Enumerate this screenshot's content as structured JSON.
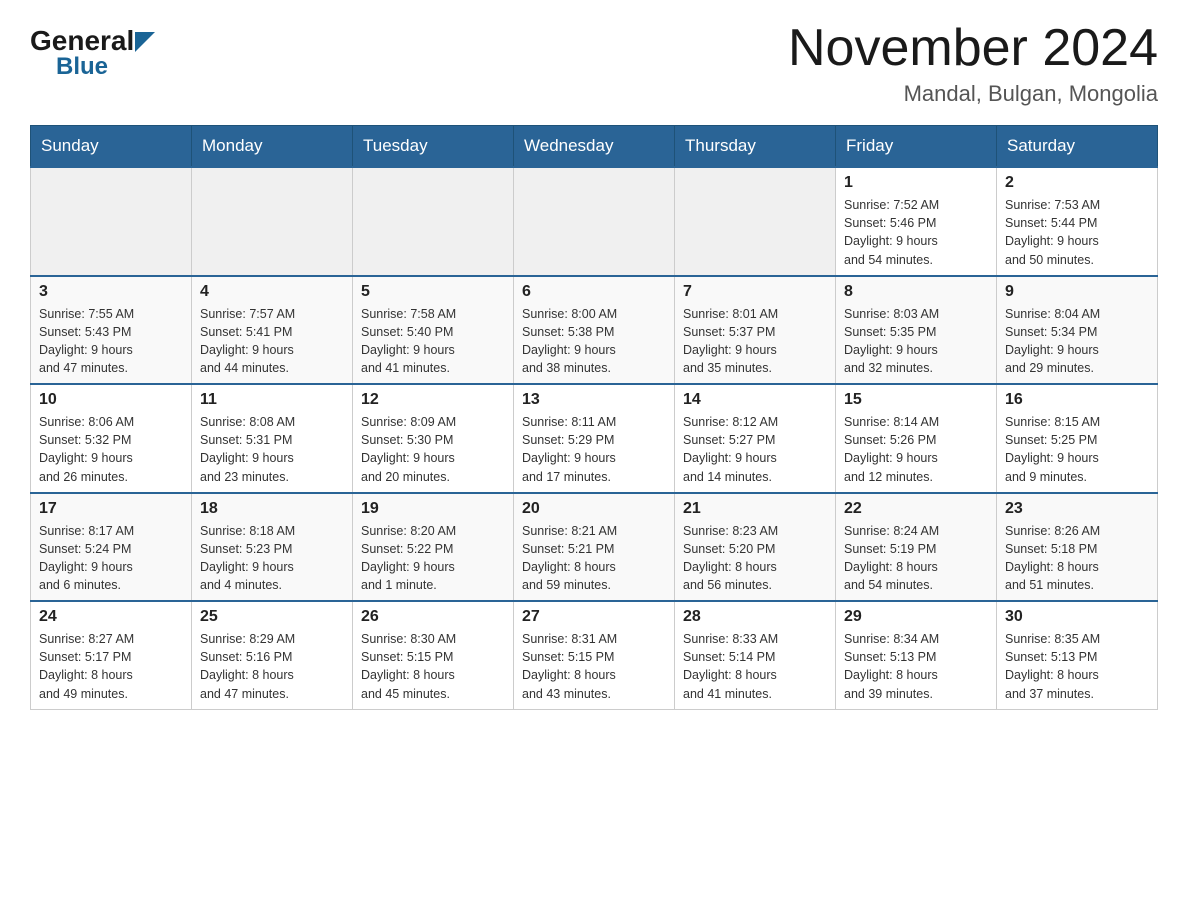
{
  "header": {
    "logo_general": "General",
    "logo_blue": "Blue",
    "title": "November 2024",
    "subtitle": "Mandal, Bulgan, Mongolia"
  },
  "weekdays": [
    "Sunday",
    "Monday",
    "Tuesday",
    "Wednesday",
    "Thursday",
    "Friday",
    "Saturday"
  ],
  "weeks": [
    [
      {
        "day": "",
        "info": ""
      },
      {
        "day": "",
        "info": ""
      },
      {
        "day": "",
        "info": ""
      },
      {
        "day": "",
        "info": ""
      },
      {
        "day": "",
        "info": ""
      },
      {
        "day": "1",
        "info": "Sunrise: 7:52 AM\nSunset: 5:46 PM\nDaylight: 9 hours\nand 54 minutes."
      },
      {
        "day": "2",
        "info": "Sunrise: 7:53 AM\nSunset: 5:44 PM\nDaylight: 9 hours\nand 50 minutes."
      }
    ],
    [
      {
        "day": "3",
        "info": "Sunrise: 7:55 AM\nSunset: 5:43 PM\nDaylight: 9 hours\nand 47 minutes."
      },
      {
        "day": "4",
        "info": "Sunrise: 7:57 AM\nSunset: 5:41 PM\nDaylight: 9 hours\nand 44 minutes."
      },
      {
        "day": "5",
        "info": "Sunrise: 7:58 AM\nSunset: 5:40 PM\nDaylight: 9 hours\nand 41 minutes."
      },
      {
        "day": "6",
        "info": "Sunrise: 8:00 AM\nSunset: 5:38 PM\nDaylight: 9 hours\nand 38 minutes."
      },
      {
        "day": "7",
        "info": "Sunrise: 8:01 AM\nSunset: 5:37 PM\nDaylight: 9 hours\nand 35 minutes."
      },
      {
        "day": "8",
        "info": "Sunrise: 8:03 AM\nSunset: 5:35 PM\nDaylight: 9 hours\nand 32 minutes."
      },
      {
        "day": "9",
        "info": "Sunrise: 8:04 AM\nSunset: 5:34 PM\nDaylight: 9 hours\nand 29 minutes."
      }
    ],
    [
      {
        "day": "10",
        "info": "Sunrise: 8:06 AM\nSunset: 5:32 PM\nDaylight: 9 hours\nand 26 minutes."
      },
      {
        "day": "11",
        "info": "Sunrise: 8:08 AM\nSunset: 5:31 PM\nDaylight: 9 hours\nand 23 minutes."
      },
      {
        "day": "12",
        "info": "Sunrise: 8:09 AM\nSunset: 5:30 PM\nDaylight: 9 hours\nand 20 minutes."
      },
      {
        "day": "13",
        "info": "Sunrise: 8:11 AM\nSunset: 5:29 PM\nDaylight: 9 hours\nand 17 minutes."
      },
      {
        "day": "14",
        "info": "Sunrise: 8:12 AM\nSunset: 5:27 PM\nDaylight: 9 hours\nand 14 minutes."
      },
      {
        "day": "15",
        "info": "Sunrise: 8:14 AM\nSunset: 5:26 PM\nDaylight: 9 hours\nand 12 minutes."
      },
      {
        "day": "16",
        "info": "Sunrise: 8:15 AM\nSunset: 5:25 PM\nDaylight: 9 hours\nand 9 minutes."
      }
    ],
    [
      {
        "day": "17",
        "info": "Sunrise: 8:17 AM\nSunset: 5:24 PM\nDaylight: 9 hours\nand 6 minutes."
      },
      {
        "day": "18",
        "info": "Sunrise: 8:18 AM\nSunset: 5:23 PM\nDaylight: 9 hours\nand 4 minutes."
      },
      {
        "day": "19",
        "info": "Sunrise: 8:20 AM\nSunset: 5:22 PM\nDaylight: 9 hours\nand 1 minute."
      },
      {
        "day": "20",
        "info": "Sunrise: 8:21 AM\nSunset: 5:21 PM\nDaylight: 8 hours\nand 59 minutes."
      },
      {
        "day": "21",
        "info": "Sunrise: 8:23 AM\nSunset: 5:20 PM\nDaylight: 8 hours\nand 56 minutes."
      },
      {
        "day": "22",
        "info": "Sunrise: 8:24 AM\nSunset: 5:19 PM\nDaylight: 8 hours\nand 54 minutes."
      },
      {
        "day": "23",
        "info": "Sunrise: 8:26 AM\nSunset: 5:18 PM\nDaylight: 8 hours\nand 51 minutes."
      }
    ],
    [
      {
        "day": "24",
        "info": "Sunrise: 8:27 AM\nSunset: 5:17 PM\nDaylight: 8 hours\nand 49 minutes."
      },
      {
        "day": "25",
        "info": "Sunrise: 8:29 AM\nSunset: 5:16 PM\nDaylight: 8 hours\nand 47 minutes."
      },
      {
        "day": "26",
        "info": "Sunrise: 8:30 AM\nSunset: 5:15 PM\nDaylight: 8 hours\nand 45 minutes."
      },
      {
        "day": "27",
        "info": "Sunrise: 8:31 AM\nSunset: 5:15 PM\nDaylight: 8 hours\nand 43 minutes."
      },
      {
        "day": "28",
        "info": "Sunrise: 8:33 AM\nSunset: 5:14 PM\nDaylight: 8 hours\nand 41 minutes."
      },
      {
        "day": "29",
        "info": "Sunrise: 8:34 AM\nSunset: 5:13 PM\nDaylight: 8 hours\nand 39 minutes."
      },
      {
        "day": "30",
        "info": "Sunrise: 8:35 AM\nSunset: 5:13 PM\nDaylight: 8 hours\nand 37 minutes."
      }
    ]
  ]
}
